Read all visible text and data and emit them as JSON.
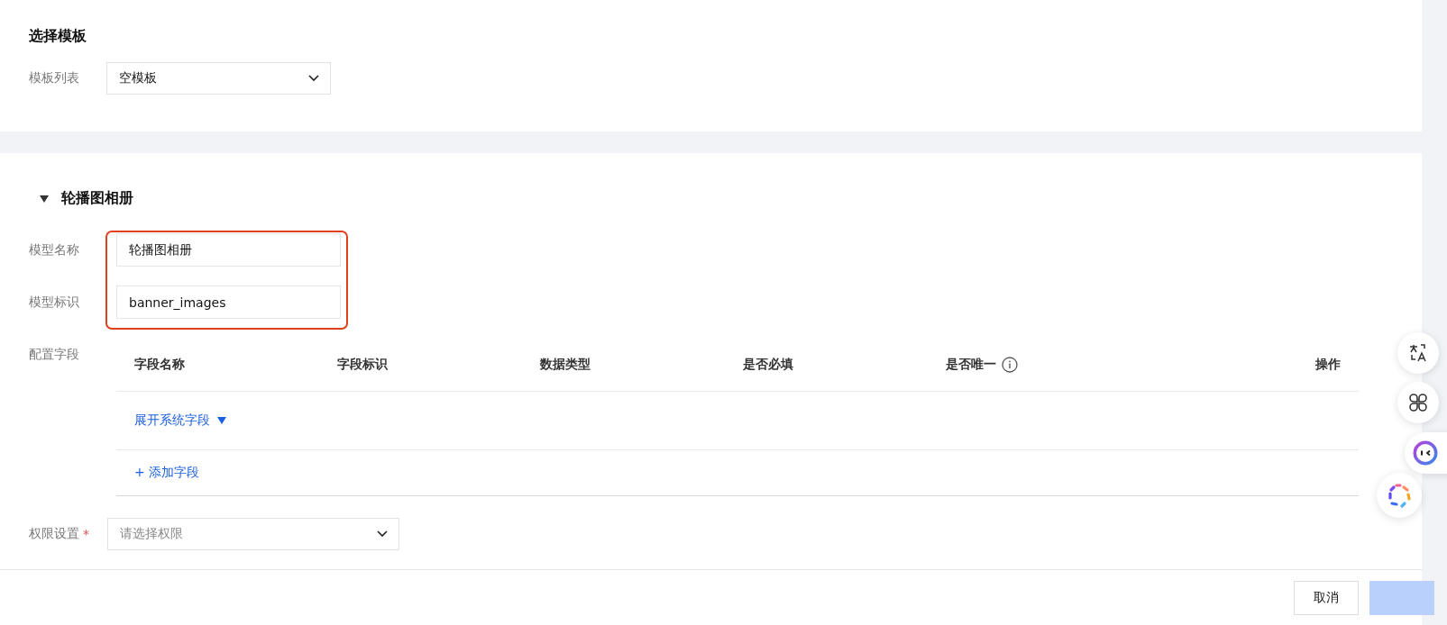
{
  "template_section": {
    "title": "选择模板",
    "field": {
      "label": "模板列表",
      "value": "空模板"
    }
  },
  "model_section": {
    "title": "轮播图相册",
    "expanded": true,
    "fields": [
      {
        "label": "模型名称",
        "value": "轮播图相册"
      },
      {
        "label": "模型标识",
        "value": "banner_images"
      }
    ],
    "config": {
      "label": "配置字段",
      "columns": [
        {
          "label": "字段名称",
          "info": false
        },
        {
          "label": "字段标识",
          "info": false
        },
        {
          "label": "数据类型",
          "info": false
        },
        {
          "label": "是否必填",
          "info": false
        },
        {
          "label": "是否唯一",
          "info": true
        },
        {
          "label": "操作",
          "info": false
        }
      ],
      "expand_link": "展开系统字段",
      "add_link": "+ 添加字段"
    },
    "permission": {
      "label": "权限设置",
      "required_mark": "*",
      "placeholder": "请选择权限"
    }
  },
  "footer": {
    "buttons": [
      {
        "label": "取消",
        "kind": "secondary"
      },
      {
        "kind": "primary"
      }
    ]
  }
}
